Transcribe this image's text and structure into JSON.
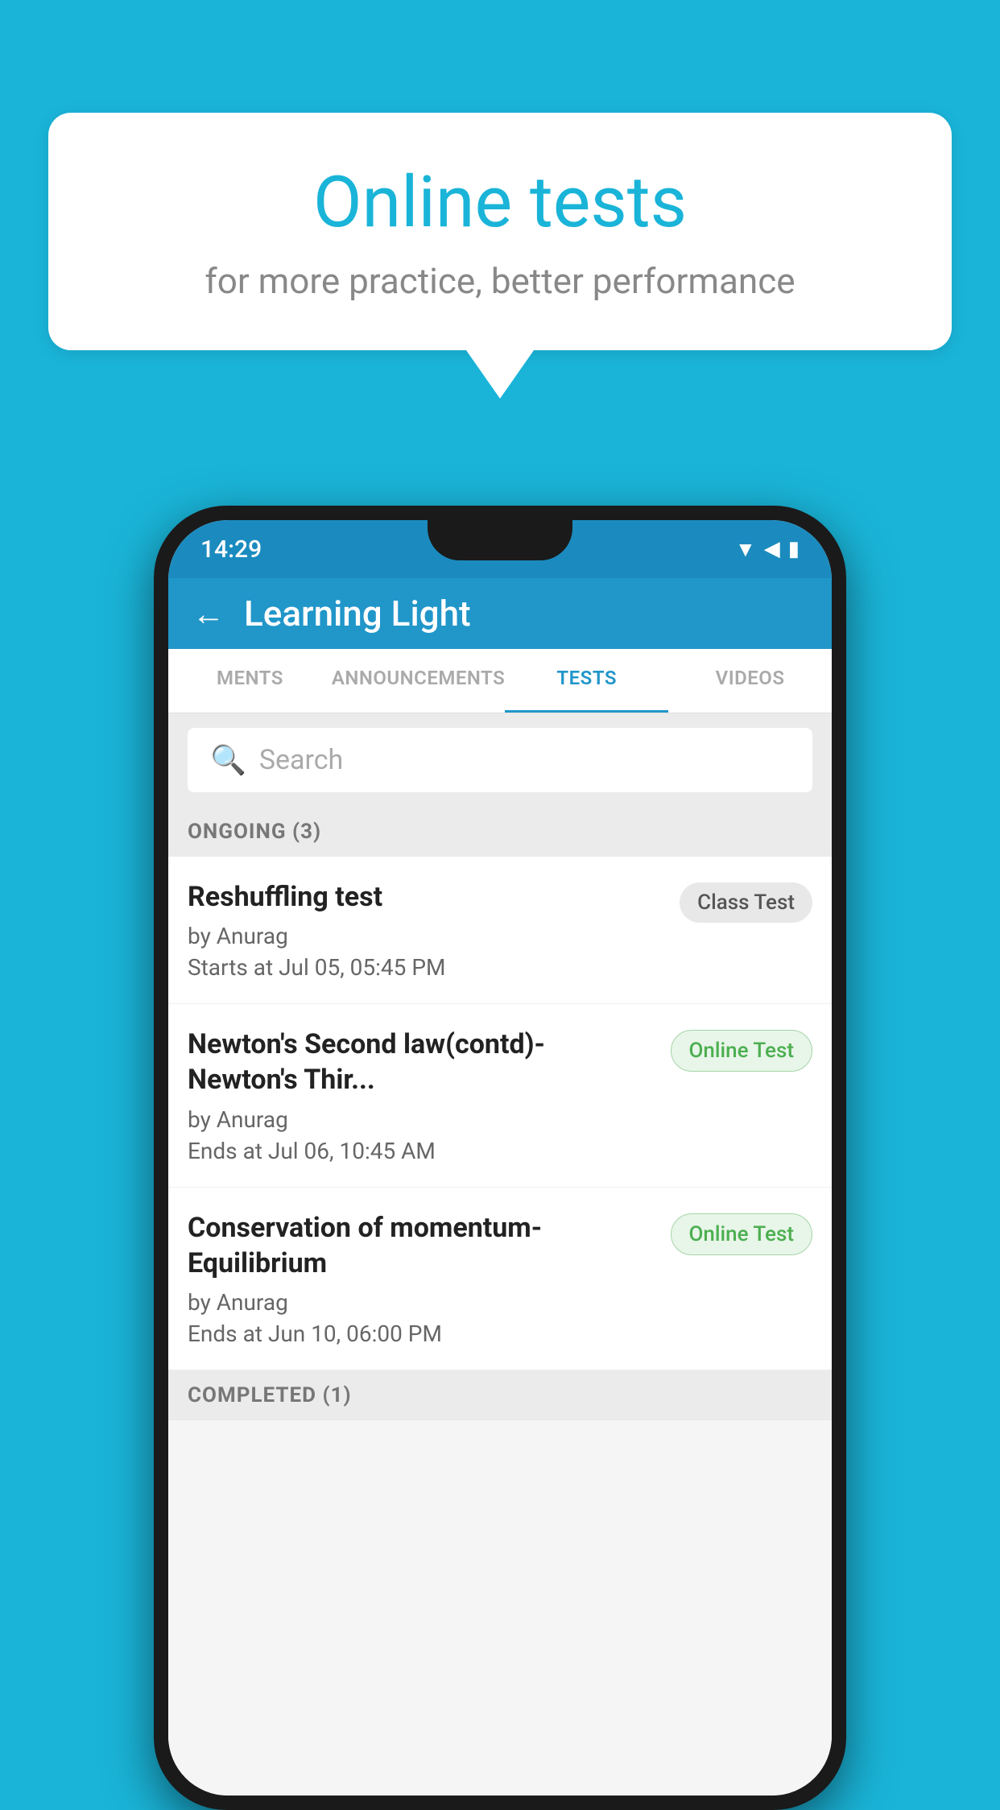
{
  "background": {
    "color": "#1ab4d8"
  },
  "speech_bubble": {
    "title": "Online tests",
    "subtitle": "for more practice, better performance"
  },
  "phone": {
    "status_bar": {
      "time": "14:29",
      "icons": [
        "wifi",
        "signal",
        "battery"
      ]
    },
    "app_header": {
      "back_label": "←",
      "title": "Learning Light"
    },
    "tabs": [
      {
        "label": "MENTS",
        "active": false
      },
      {
        "label": "ANNOUNCEMENTS",
        "active": false
      },
      {
        "label": "TESTS",
        "active": true
      },
      {
        "label": "VIDEOS",
        "active": false
      }
    ],
    "search": {
      "placeholder": "Search"
    },
    "sections": [
      {
        "header": "ONGOING (3)",
        "tests": [
          {
            "name": "Reshuffling test",
            "by": "by Anurag",
            "date": "Starts at  Jul 05, 05:45 PM",
            "badge": "Class Test",
            "badge_type": "class"
          },
          {
            "name": "Newton's Second law(contd)-Newton's Thir...",
            "by": "by Anurag",
            "date": "Ends at  Jul 06, 10:45 AM",
            "badge": "Online Test",
            "badge_type": "online"
          },
          {
            "name": "Conservation of momentum-Equilibrium",
            "by": "by Anurag",
            "date": "Ends at  Jun 10, 06:00 PM",
            "badge": "Online Test",
            "badge_type": "online"
          }
        ]
      },
      {
        "header": "COMPLETED (1)",
        "tests": []
      }
    ]
  }
}
